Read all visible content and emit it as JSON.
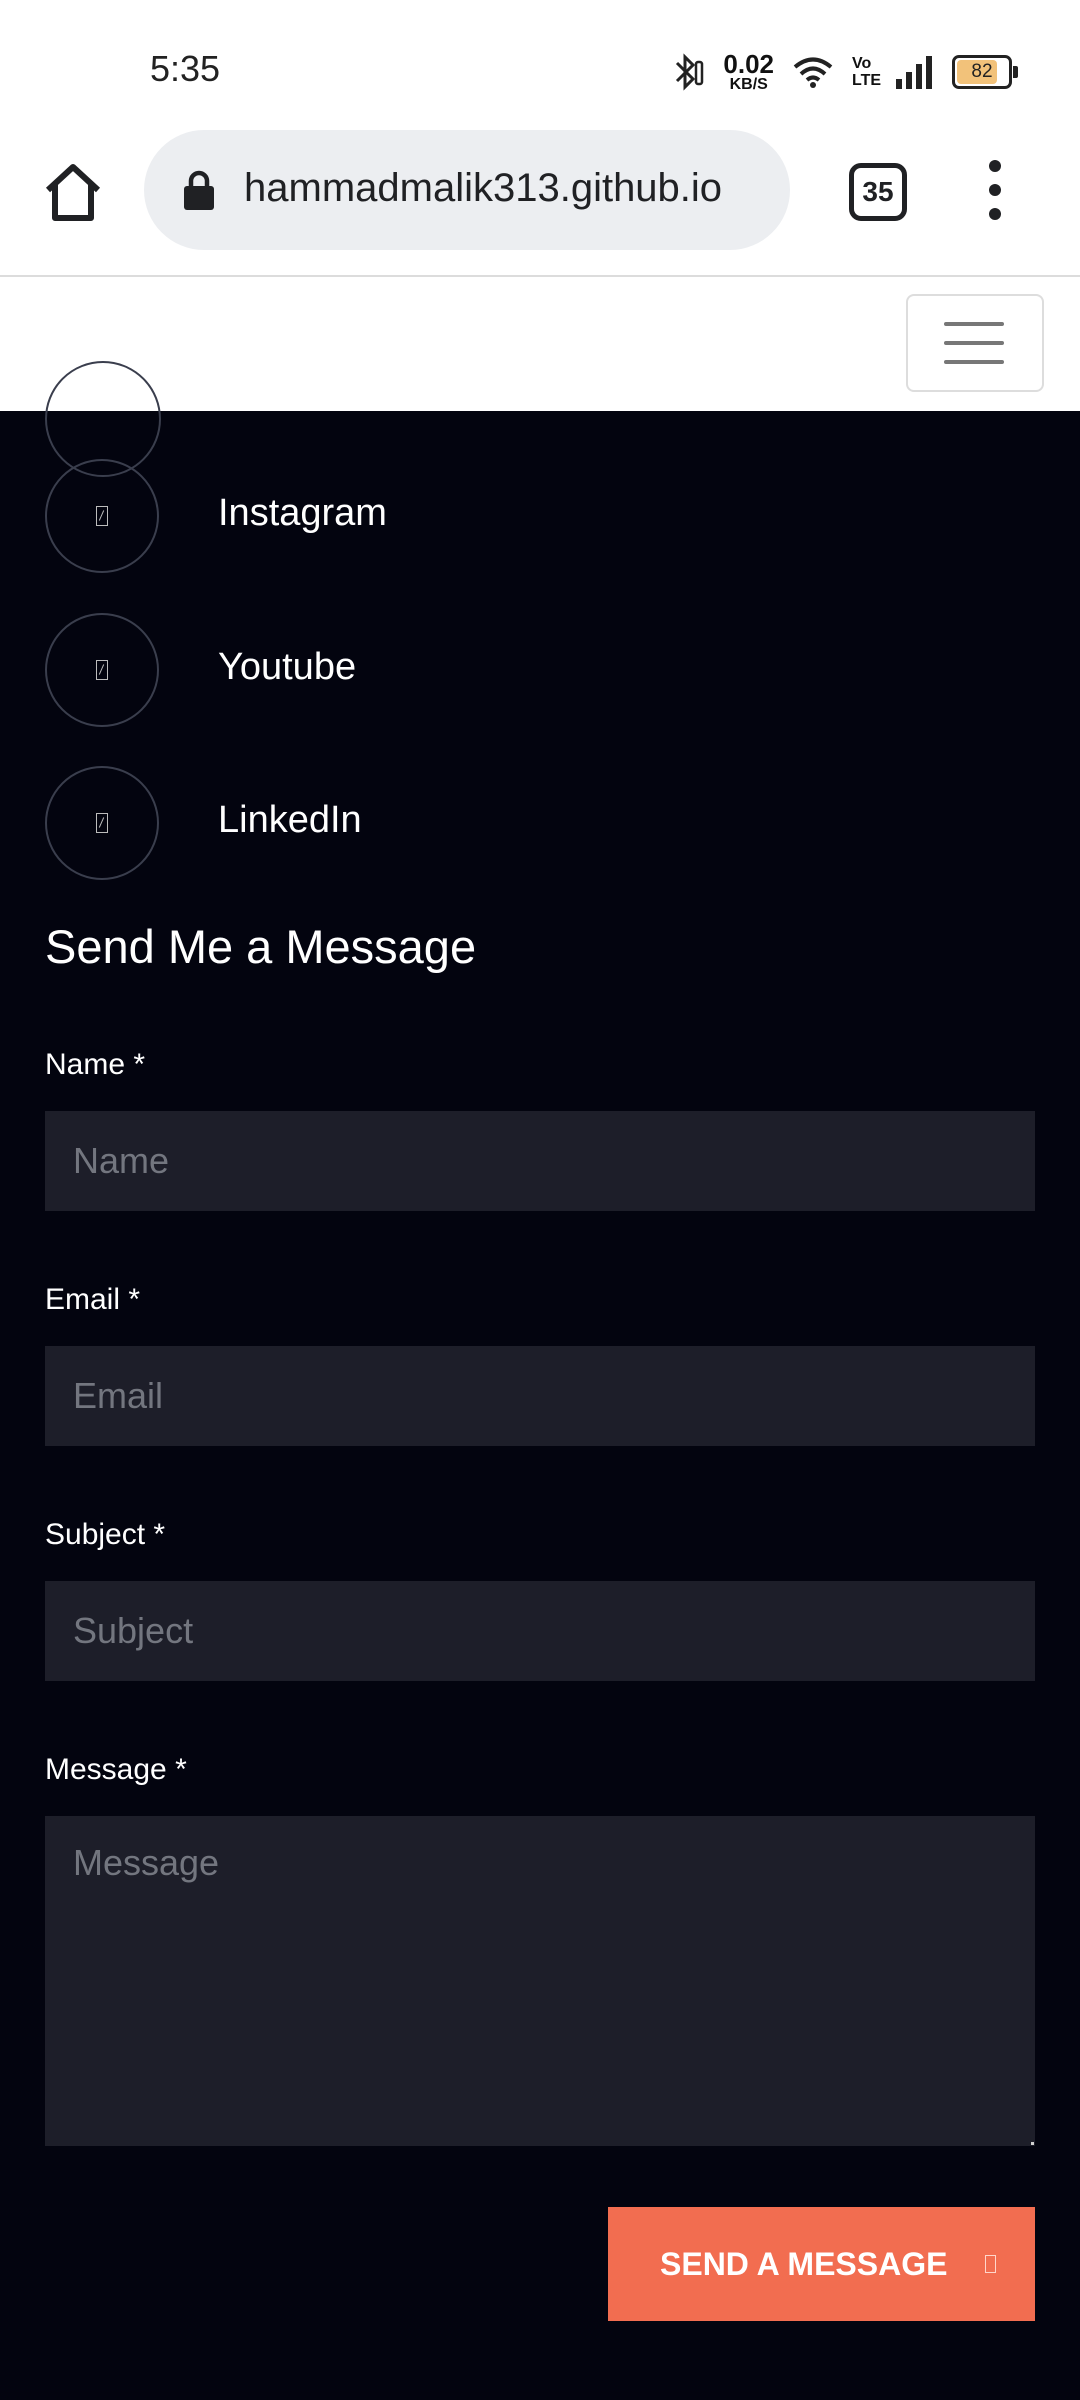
{
  "status_bar": {
    "time": "5:35",
    "net_speed_value": "0.02",
    "net_speed_unit": "KB/S",
    "volte_top": "Vo",
    "volte_bottom": "LTE",
    "battery": "82",
    "battery_level_percent": 82,
    "battery_fill_color": "#f2c27a"
  },
  "browser": {
    "url": "hammadmalik313.github.io",
    "tab_count": "35"
  },
  "social": {
    "items": [
      {
        "label": "Instagram",
        "icon": "instagram-icon"
      },
      {
        "label": "Youtube",
        "icon": "youtube-icon"
      },
      {
        "label": "LinkedIn",
        "icon": "linkedin-icon"
      }
    ]
  },
  "contact_form": {
    "title": "Send Me a Message",
    "name_label": "Name *",
    "name_placeholder": "Name",
    "email_label": "Email *",
    "email_placeholder": "Email",
    "subject_label": "Subject *",
    "subject_placeholder": "Subject",
    "message_label": "Message *",
    "message_placeholder": "Message",
    "submit_label": "SEND A MESSAGE",
    "submit_color": "#f26d50"
  },
  "theme": {
    "page_background": "#03040f",
    "input_background": "#1d1e29"
  }
}
